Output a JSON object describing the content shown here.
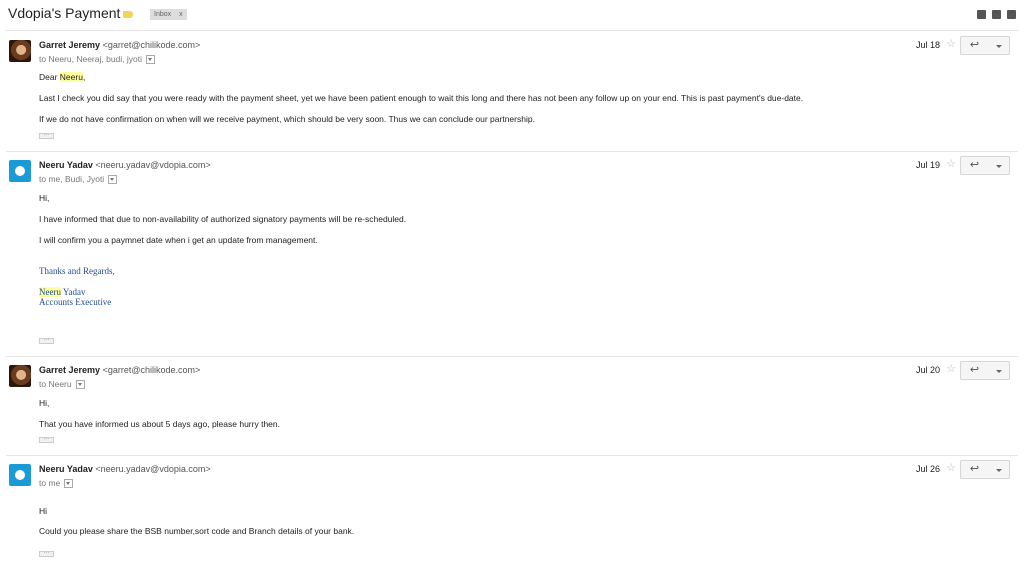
{
  "subject": "Vdopia's Payment",
  "label_chip": {
    "text": "Inbox",
    "close": "x"
  },
  "colors": {
    "label_tag": "#f5d35a",
    "highlight": "#ffff9e",
    "signature": "#1f4e8f"
  },
  "messages": [
    {
      "sender_name": "Garret Jeremy",
      "sender_email": "<garret@chilikode.com>",
      "recipients": "to Neeru, Neeraj, budi, jyoti",
      "date": "Jul 18",
      "greeting_prefix": "Dear ",
      "greeting_name": "Neeru",
      "greeting_suffix": ",",
      "lines": [
        "Last I check you did say that you were ready with the payment sheet, yet we have been patient enough to wait this long and there has not been any follow up on your end. This is past payment's due-date.",
        "If we do not have confirmation on when will we receive payment, which should be very soon. Thus we can conclude our partnership."
      ]
    },
    {
      "sender_name": "Neeru Yadav",
      "sender_email": "<neeru.yadav@vdopia.com>",
      "recipients": "to me, Budi, Jyoti",
      "date": "Jul 19",
      "lines": [
        "Hi,",
        "I have informed that due to non-availability of authorized signatory payments will be re-scheduled.",
        "I will confirm you a paymnet date when i get an update from management."
      ],
      "signature": {
        "closing": "Thanks and Regards,",
        "first_name": "Neeru",
        "last_name": " Yadav",
        "title": "Accounts Executive"
      }
    },
    {
      "sender_name": "Garret Jeremy",
      "sender_email": "<garret@chilikode.com>",
      "recipients": "to Neeru",
      "date": "Jul 20",
      "lines": [
        "Hi,",
        "That you have informed us about 5 days ago, please hurry then."
      ]
    },
    {
      "sender_name": "Neeru Yadav",
      "sender_email": "<neeru.yadav@vdopia.com>",
      "recipients": "to me",
      "date": "Jul 26",
      "lines": [
        "Hi",
        "Could you please share the BSB number,sort code and Branch details of your bank."
      ]
    }
  ],
  "icons": {
    "star": "☆",
    "reply": "↩",
    "ellipsis": "···"
  }
}
